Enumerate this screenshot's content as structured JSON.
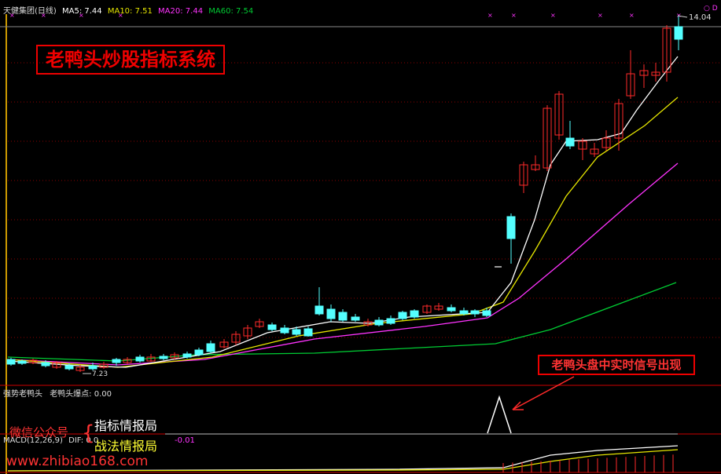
{
  "main_header": {
    "stock": "天健集团(日线)",
    "ma5": "MA5: 7.44",
    "ma10": "MA10: 7.51",
    "ma20": "MA20: 7.44",
    "ma60": "MA60: 7.54"
  },
  "title_box": "老鸭头炒股指标系统",
  "price_high": "14.04",
  "price_low": "7.23",
  "signal_box": "老鸭头盘中实时信号出现",
  "indicator_header": {
    "name": "强势老鸭头",
    "value": "老鸭头爆点: 0.00"
  },
  "macd_header": {
    "name": "MACD(12,26,9)",
    "dif": "DIF: 0.0",
    "tail": "-0.01"
  },
  "watermark": {
    "wechat_label": "微信公众号",
    "line1": "指标情报局",
    "line2": "战法情报局",
    "url": "www.zhibiao168.com"
  },
  "colors": {
    "up": "#ff2a2a",
    "down": "#54ffff",
    "ma5": "#ffffff",
    "ma10": "#e6e600",
    "ma20": "#ff33ff",
    "ma60": "#00cc33",
    "grid": "#8b0000"
  }
}
